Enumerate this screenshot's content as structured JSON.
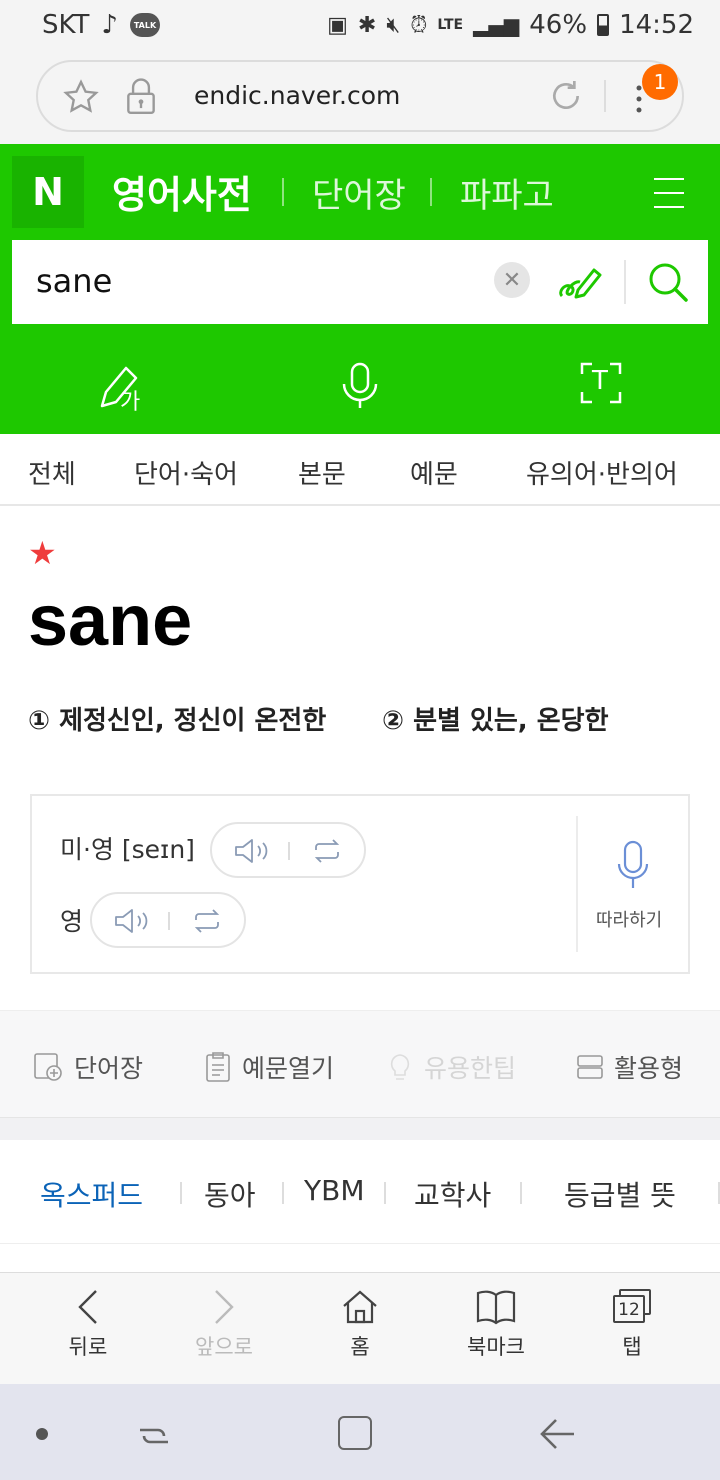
{
  "status_bar": {
    "carrier": "SKT",
    "talk_label": "TALK",
    "network": "LTE",
    "battery": "46%",
    "time": "14:52"
  },
  "browser": {
    "url": "endic.naver.com",
    "notification_count": "1"
  },
  "header": {
    "logo": "N",
    "title": "영어사전",
    "links": [
      "단어장",
      "파파고"
    ]
  },
  "search": {
    "query": "sane"
  },
  "tools": {
    "handwriting_label": "가",
    "ocr_label": "T"
  },
  "tabs": [
    "전체",
    "단어·숙어",
    "본문",
    "예문",
    "유의어·반의어"
  ],
  "entry": {
    "word": "sane",
    "star": "★",
    "meanings": [
      "① 제정신인, 정신이 온전한",
      "② 분별 있는, 온당한"
    ]
  },
  "pronunciation": {
    "us_uk_label": "미·영 [seɪn]",
    "uk_label": "영",
    "follow_label": "따라하기"
  },
  "actions": {
    "wordbook": "단어장",
    "open_examples": "예문열기",
    "tips": "유용한팁",
    "inflection": "활용형"
  },
  "sources": [
    "옥스퍼드",
    "동아",
    "YBM",
    "교학사",
    "등급별 뜻"
  ],
  "bottom_bar": {
    "back": "뒤로",
    "forward": "앞으로",
    "home": "홈",
    "bookmarks": "북마크",
    "tabs": "탭",
    "tab_count": "12"
  },
  "colors": {
    "naver_green": "#1ec800",
    "active_source": "#0b63b7",
    "star": "#ef3c3c",
    "badge": "#ff6b00"
  }
}
